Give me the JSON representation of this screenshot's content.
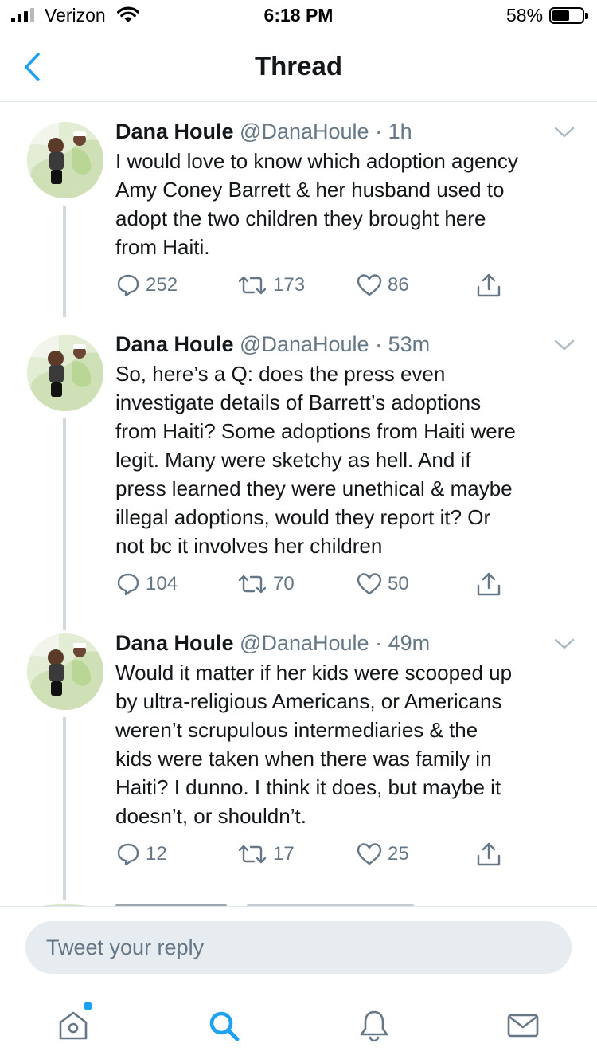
{
  "status_bar": {
    "carrier": "Verizon",
    "time": "6:18 PM",
    "battery_percent": "58%",
    "battery_level": 0.58
  },
  "header": {
    "title": "Thread",
    "back_icon": "chevron-left-icon"
  },
  "tweets": [
    {
      "name": "Dana Houle",
      "handle": "@DanaHoule",
      "time": "1h",
      "text": "I would love to know which adoption agency\nAmy Coney Barrett & her husband used to\nadopt the two children they brought here\nfrom Haiti.",
      "replies": "252",
      "retweets": "173",
      "likes": "86"
    },
    {
      "name": "Dana Houle",
      "handle": "@DanaHoule",
      "time": "53m",
      "text": "So, here’s a Q: does the press even\ninvestigate details of Barrett’s adoptions\nfrom Haiti? Some adoptions from Haiti were\nlegit. Many were sketchy as hell. And if\npress learned they were unethical & maybe\nillegal adoptions, would they report it? Or\nnot bc it involves her children",
      "replies": "104",
      "retweets": "70",
      "likes": "50"
    },
    {
      "name": "Dana Houle",
      "handle": "@DanaHoule",
      "time": "49m",
      "text": "Would it matter if her kids were scooped up\nby ultra-religious Americans, or Americans\nweren’t scrupulous intermediaries & the\nkids were taken when there was family in\nHaiti? I dunno. I think it does, but maybe it\ndoesn’t, or shouldn’t.",
      "replies": "12",
      "retweets": "17",
      "likes": "25"
    }
  ],
  "reply": {
    "placeholder": "Tweet your reply"
  },
  "tab_bar": {
    "items": [
      "home-icon",
      "search-icon",
      "notifications-bell-icon",
      "messages-envelope-icon"
    ],
    "active": "search-icon",
    "accent": "#1da1f2",
    "icon_color": "#657786"
  },
  "colors": {
    "accent": "#1da1f2",
    "secondary_text": "#657786",
    "divider": "#e1e8ed",
    "thread_line": "#cfd9de",
    "reply_bg": "#e6ecf0"
  }
}
